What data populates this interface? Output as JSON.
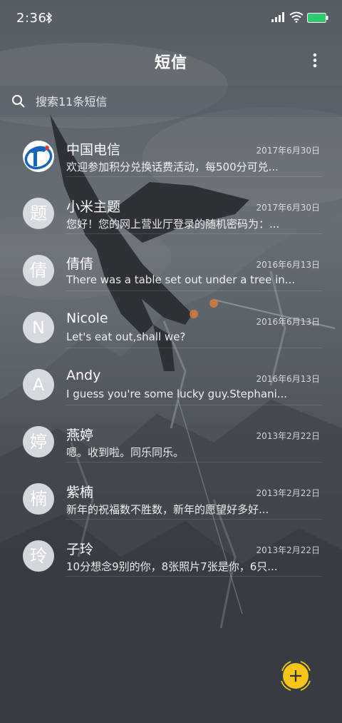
{
  "status_bar": {
    "time": "2:36",
    "icons": [
      "bluetooth-icon",
      "signal-icon",
      "wifi-icon",
      "battery-icon"
    ]
  },
  "header": {
    "title": "短信",
    "menu_icon": "more-vertical-icon"
  },
  "search": {
    "placeholder": "搜索11条短信",
    "icon": "search-icon"
  },
  "conversations": [
    {
      "avatar": "",
      "avatar_type": "logo",
      "name": "中国电信",
      "date": "2017年6月30日",
      "preview": "欢迎参加积分兑换话费活动，每500分可兑..."
    },
    {
      "avatar": "题",
      "avatar_type": "initial",
      "name": "小米主题",
      "date": "2017年6月30日",
      "preview": "您好！您的网上营业厅登录的随机密码为：..."
    },
    {
      "avatar": "倩",
      "avatar_type": "initial",
      "name": "倩倩",
      "date": "2016年6月13日",
      "preview": "There was a table set out under a tree in..."
    },
    {
      "avatar": "N",
      "avatar_type": "initial",
      "name": "Nicole",
      "date": "2016年6月13日",
      "preview": "Let's eat out,shall we?"
    },
    {
      "avatar": "A",
      "avatar_type": "initial",
      "name": "Andy",
      "date": "2016年6月13日",
      "preview": "I guess you're some lucky guy.Stephani..."
    },
    {
      "avatar": "婷",
      "avatar_type": "initial",
      "name": "燕婷",
      "date": "2013年2月22日",
      "preview": "嗯。收到啦。同乐同乐。"
    },
    {
      "avatar": "楠",
      "avatar_type": "initial",
      "name": "紫楠",
      "date": "2013年2月22日",
      "preview": "新年的祝福数不胜数，新年的愿望好多好..."
    },
    {
      "avatar": "玲",
      "avatar_type": "initial",
      "name": "子玲",
      "date": "2013年2月22日",
      "preview": "10分想念9别的你，8张照片7张是你，6只..."
    }
  ],
  "fab": {
    "icon": "plus-icon",
    "color": "#f5c518"
  },
  "colors": {
    "accent": "#f5c518",
    "telecom_blue": "#1565c0"
  }
}
